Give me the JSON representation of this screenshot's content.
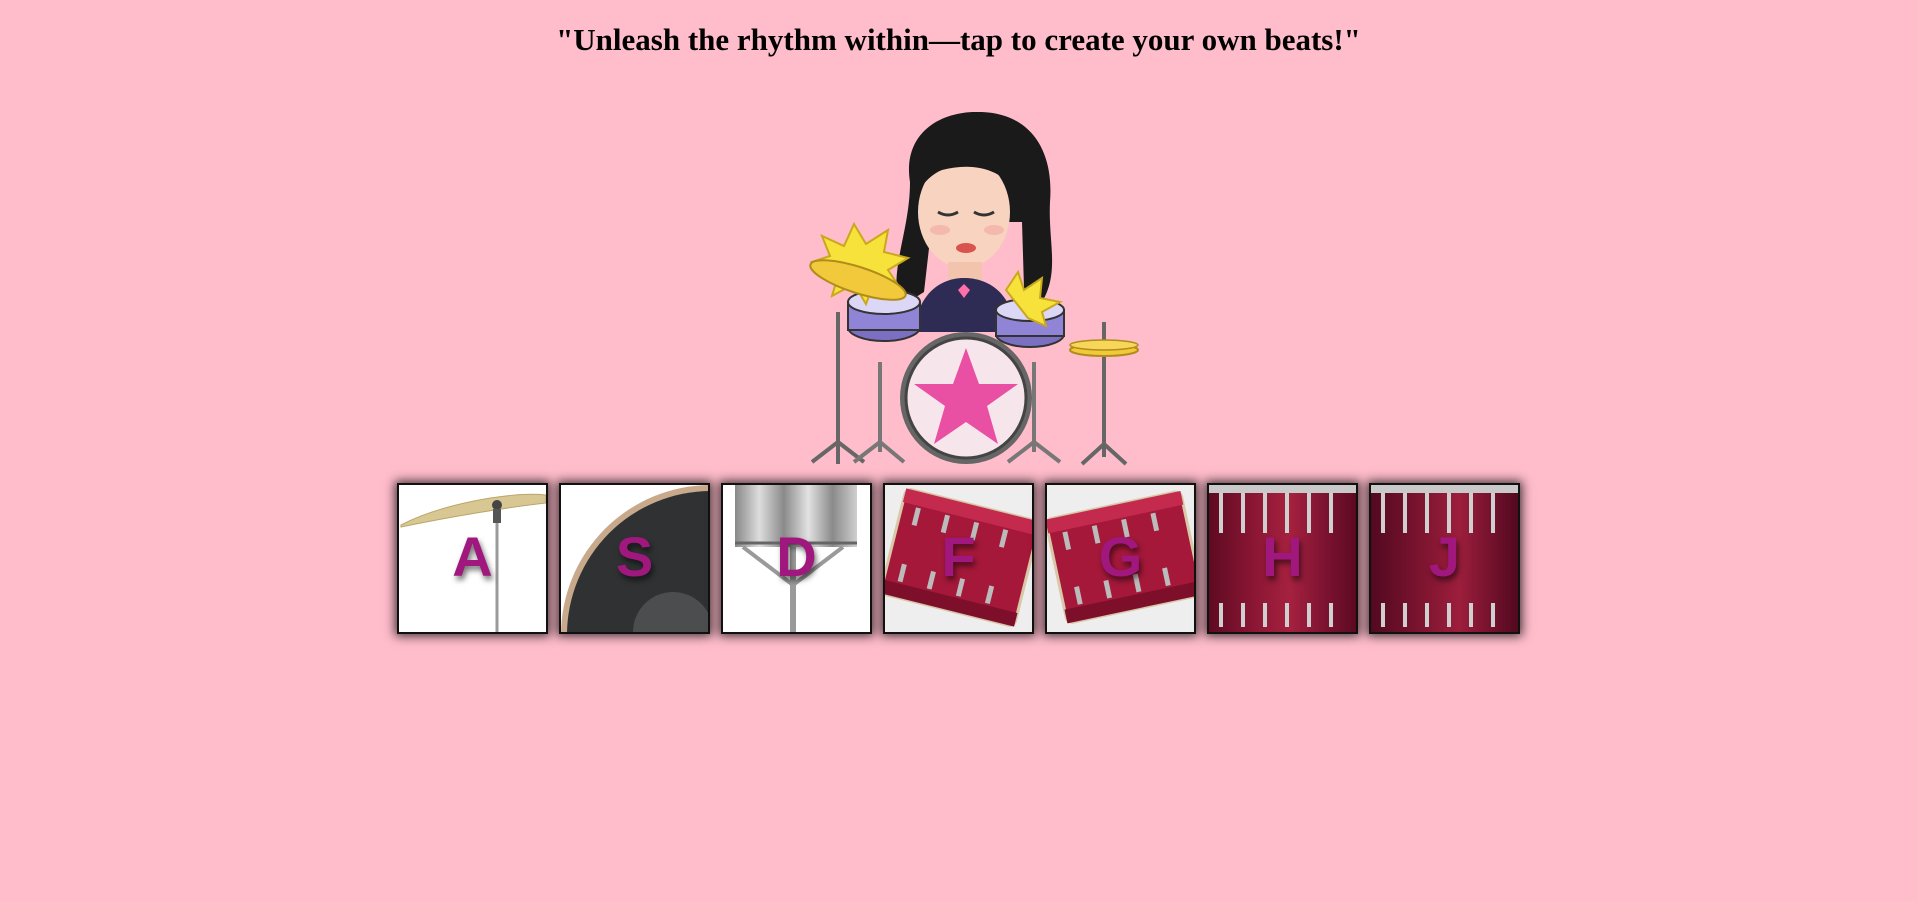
{
  "page": {
    "tagline": "\"Unleash the rhythm within—tap to create your own beats!\"",
    "background_color": "#ffbccb"
  },
  "drummer": {
    "illustration": "girl-playing-drum-kit",
    "star_color": "#e94fa2",
    "hair_color": "#1a1a1a",
    "cymbal_color": "#f4d93a"
  },
  "keys": [
    {
      "letter": "A",
      "instrument": "crash-cymbal",
      "art": "cymbal"
    },
    {
      "letter": "S",
      "instrument": "kick-drum",
      "art": "kick"
    },
    {
      "letter": "D",
      "instrument": "hi-hat",
      "art": "hihat"
    },
    {
      "letter": "F",
      "instrument": "tom-1",
      "art": "tom-tilt"
    },
    {
      "letter": "G",
      "instrument": "tom-2",
      "art": "tom-tilt2"
    },
    {
      "letter": "H",
      "instrument": "floor-tom-1",
      "art": "floor"
    },
    {
      "letter": "J",
      "instrument": "floor-tom-2",
      "art": "floor"
    }
  ],
  "colors": {
    "key_letter": "#a0177e",
    "drum_red": "#a5183a"
  }
}
